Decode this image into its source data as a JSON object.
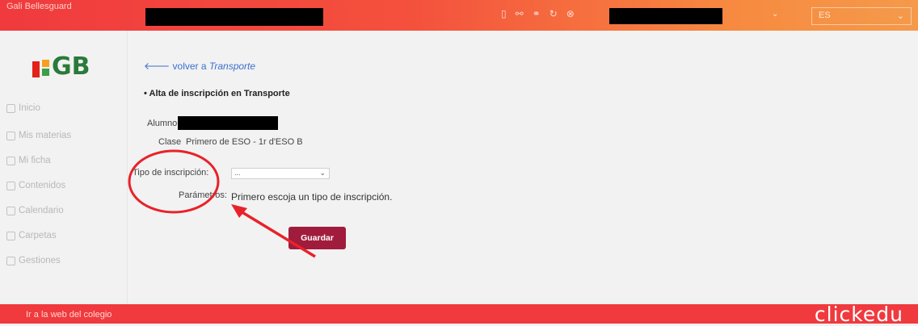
{
  "header": {
    "school_name": "Gali Bellesguard",
    "icons": [
      "mobile-icon",
      "share-icon",
      "users-icon",
      "chat-icon",
      "close-circle-icon"
    ],
    "language": "ES",
    "colors": {
      "bar_start": "#f03a3e",
      "bar_end": "#f49a4a"
    }
  },
  "sidebar": {
    "items": [
      {
        "icon": "home-icon",
        "label": "Inicio"
      },
      {
        "icon": "book-icon",
        "label": "Mis materias"
      },
      {
        "icon": "id-card-icon",
        "label": "Mi ficha"
      },
      {
        "icon": "contents-icon",
        "label": "Contenidos"
      },
      {
        "icon": "calendar-icon",
        "label": "Calendario"
      },
      {
        "icon": "folder-icon",
        "label": "Carpetas"
      },
      {
        "icon": "tasks-icon",
        "label": "Gestiones"
      }
    ]
  },
  "main": {
    "back_prefix": "volver a",
    "back_target": "Transporte",
    "section_title": "• Alta de inscripción en Transporte",
    "alumno_label": "Alumno",
    "clase_label": "Clase",
    "clase_value": "Primero de ESO - 1r d'ESO B",
    "tipo_label": "Tipo de inscripción:",
    "tipo_selected": "...",
    "parametros_label": "Parámetros:",
    "parametros_value": "Primero escoja un tipo de inscripción.",
    "save_label": "Guardar",
    "accent_color": "#a11c3c"
  },
  "annotation": {
    "color": "#e8222a"
  },
  "footer": {
    "link": "Ir a la web del colegio",
    "brand": "clickedu"
  }
}
